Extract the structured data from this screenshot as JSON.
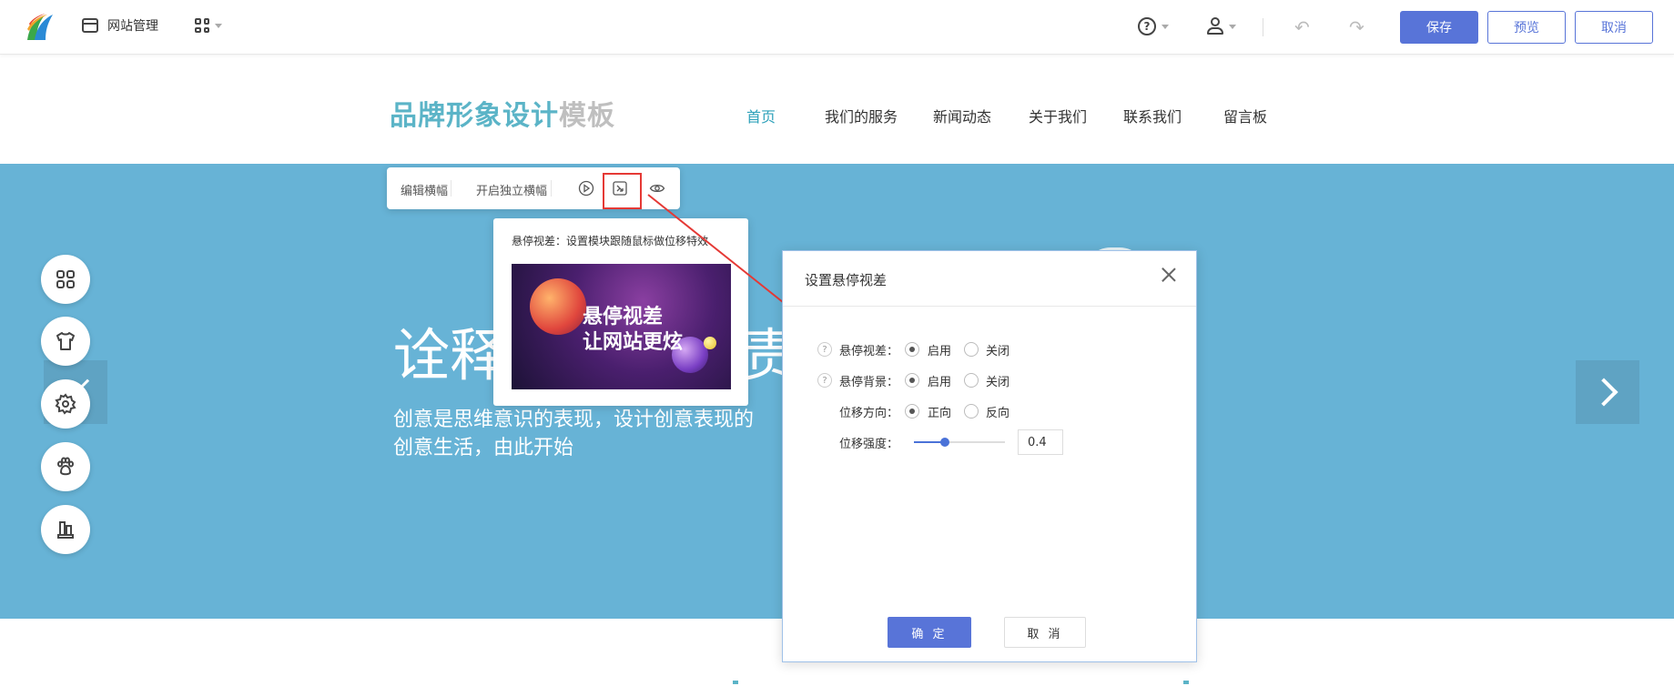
{
  "topbar": {
    "site_management": "网站管理",
    "save": "保存",
    "preview": "预览",
    "cancel": "取消"
  },
  "site": {
    "brand_primary": "品牌形象设计",
    "brand_secondary": "模板",
    "nav": [
      {
        "label": "首页",
        "active": true
      },
      {
        "label": "我们的服务"
      },
      {
        "label": "新闻动态"
      },
      {
        "label": "关于我们"
      },
      {
        "label": "联系我们"
      },
      {
        "label": "留言板"
      }
    ]
  },
  "banner": {
    "title_left": "诠释",
    "title_right": "责",
    "subtitle_line1": "创意是思维意识的表现，设计创意表现的",
    "subtitle_line2": "创意生活，由此开始"
  },
  "banner_toolbar": {
    "edit_banner": "编辑横幅",
    "independent_banner": "开启独立横幅"
  },
  "tooltip": {
    "text": "悬停视差：设置模块跟随鼠标做位移特效",
    "image_line1": "悬停视差",
    "image_line2": "让网站更炫"
  },
  "dialog": {
    "title": "设置悬停视差",
    "rows": [
      {
        "label": "悬停视差：",
        "help": "?",
        "options": [
          "启用",
          "关闭"
        ],
        "selected": 0
      },
      {
        "label": "悬停背景：",
        "help": "?",
        "options": [
          "启用",
          "关闭"
        ],
        "selected": 0
      },
      {
        "label": "位移方向：",
        "options": [
          "正向",
          "反向"
        ],
        "selected": 0
      }
    ],
    "strength_label": "位移强度：",
    "strength_value": "0.4",
    "strength_fraction": 0.34,
    "ok": "确 定",
    "cancel": "取 消"
  },
  "colors": {
    "accent": "#5874d8",
    "banner": "#67b3d6",
    "brand": "#5bb4c7",
    "nav_active": "#2ea1ba",
    "annotation": "#e53935"
  },
  "icons": {
    "side_tools": [
      "apps-icon",
      "shirt-icon",
      "gear-icon",
      "paw-icon",
      "building-icon"
    ]
  }
}
